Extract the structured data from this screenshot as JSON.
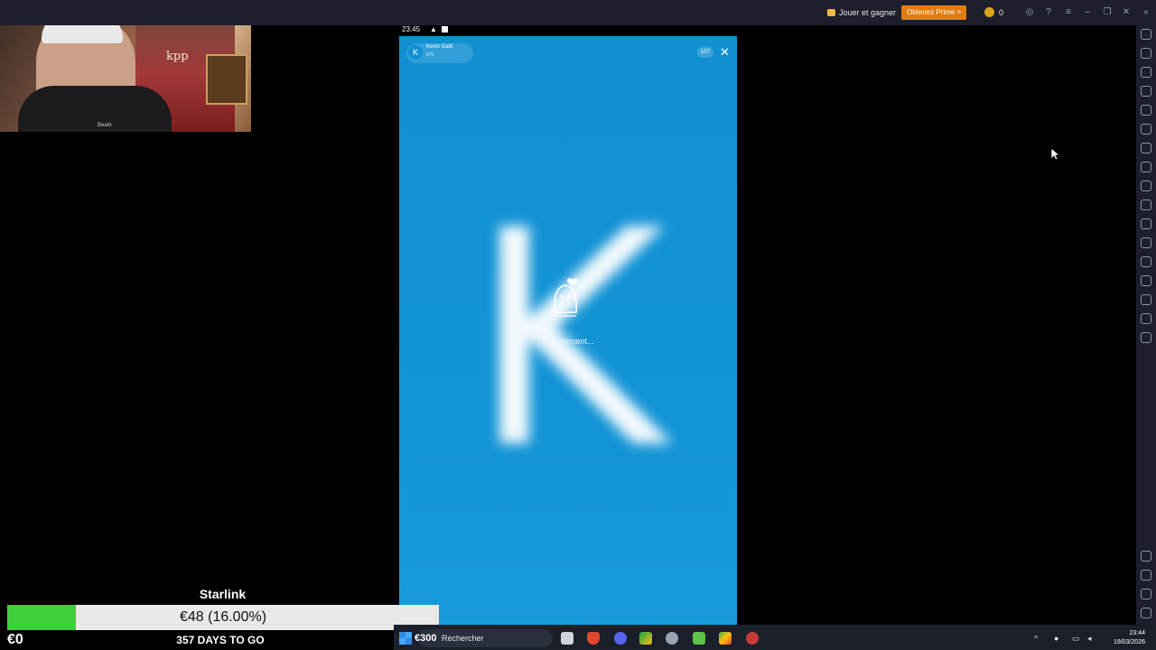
{
  "emulator": {
    "topbar": {
      "play_and_earn": "Jouer et gagner",
      "get_premium": "Obtenez Prime >",
      "coins": "0"
    }
  },
  "phone": {
    "status": {
      "time": "23:45",
      "warning": "▲"
    },
    "stream": {
      "username": "Kevin Gatti",
      "points": "970",
      "viewers": "107",
      "close": "✕",
      "avatar_letter": "K",
      "big_letter": "K",
      "loading_text": "Chargement..."
    }
  },
  "overlay": {
    "donation": {
      "title": "Starlink",
      "amount_text": "€48 (16.00%)",
      "progress_percent": 16,
      "start": "€0",
      "days_left": "357 DAYS TO GO",
      "goal": "€300"
    },
    "webcam": {
      "shirt_text": "Beam",
      "poster_text": "kpp"
    }
  },
  "taskbar": {
    "search_placeholder": "Rechercher",
    "time": "23:44",
    "date": "19/03/2026"
  },
  "colors": {
    "phone_bg": "#1190d2",
    "premium": "#e07c12",
    "progress_fill": "#3fce3c",
    "topbar": "#1d1f2c",
    "taskbar": "#1b1f2a"
  }
}
